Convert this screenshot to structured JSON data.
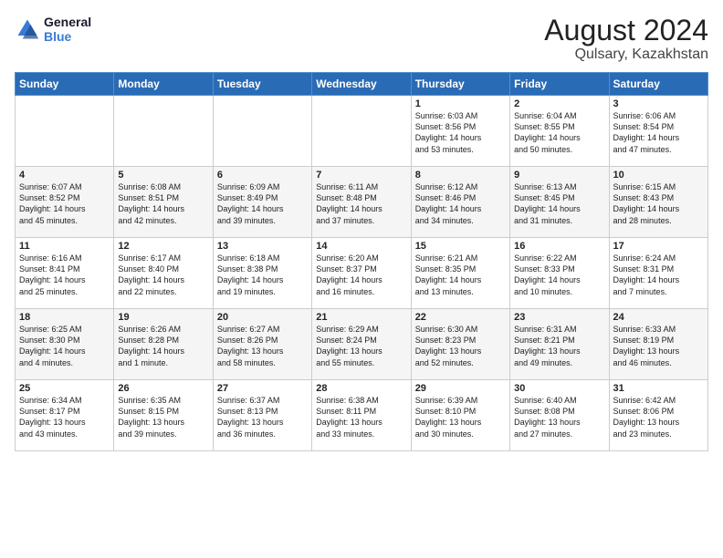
{
  "logo": {
    "line1": "General",
    "line2": "Blue"
  },
  "title": "August 2024",
  "location": "Qulsary, Kazakhstan",
  "headers": [
    "Sunday",
    "Monday",
    "Tuesday",
    "Wednesday",
    "Thursday",
    "Friday",
    "Saturday"
  ],
  "weeks": [
    [
      {
        "day": "",
        "text": ""
      },
      {
        "day": "",
        "text": ""
      },
      {
        "day": "",
        "text": ""
      },
      {
        "day": "",
        "text": ""
      },
      {
        "day": "1",
        "text": "Sunrise: 6:03 AM\nSunset: 8:56 PM\nDaylight: 14 hours\nand 53 minutes."
      },
      {
        "day": "2",
        "text": "Sunrise: 6:04 AM\nSunset: 8:55 PM\nDaylight: 14 hours\nand 50 minutes."
      },
      {
        "day": "3",
        "text": "Sunrise: 6:06 AM\nSunset: 8:54 PM\nDaylight: 14 hours\nand 47 minutes."
      }
    ],
    [
      {
        "day": "4",
        "text": "Sunrise: 6:07 AM\nSunset: 8:52 PM\nDaylight: 14 hours\nand 45 minutes."
      },
      {
        "day": "5",
        "text": "Sunrise: 6:08 AM\nSunset: 8:51 PM\nDaylight: 14 hours\nand 42 minutes."
      },
      {
        "day": "6",
        "text": "Sunrise: 6:09 AM\nSunset: 8:49 PM\nDaylight: 14 hours\nand 39 minutes."
      },
      {
        "day": "7",
        "text": "Sunrise: 6:11 AM\nSunset: 8:48 PM\nDaylight: 14 hours\nand 37 minutes."
      },
      {
        "day": "8",
        "text": "Sunrise: 6:12 AM\nSunset: 8:46 PM\nDaylight: 14 hours\nand 34 minutes."
      },
      {
        "day": "9",
        "text": "Sunrise: 6:13 AM\nSunset: 8:45 PM\nDaylight: 14 hours\nand 31 minutes."
      },
      {
        "day": "10",
        "text": "Sunrise: 6:15 AM\nSunset: 8:43 PM\nDaylight: 14 hours\nand 28 minutes."
      }
    ],
    [
      {
        "day": "11",
        "text": "Sunrise: 6:16 AM\nSunset: 8:41 PM\nDaylight: 14 hours\nand 25 minutes."
      },
      {
        "day": "12",
        "text": "Sunrise: 6:17 AM\nSunset: 8:40 PM\nDaylight: 14 hours\nand 22 minutes."
      },
      {
        "day": "13",
        "text": "Sunrise: 6:18 AM\nSunset: 8:38 PM\nDaylight: 14 hours\nand 19 minutes."
      },
      {
        "day": "14",
        "text": "Sunrise: 6:20 AM\nSunset: 8:37 PM\nDaylight: 14 hours\nand 16 minutes."
      },
      {
        "day": "15",
        "text": "Sunrise: 6:21 AM\nSunset: 8:35 PM\nDaylight: 14 hours\nand 13 minutes."
      },
      {
        "day": "16",
        "text": "Sunrise: 6:22 AM\nSunset: 8:33 PM\nDaylight: 14 hours\nand 10 minutes."
      },
      {
        "day": "17",
        "text": "Sunrise: 6:24 AM\nSunset: 8:31 PM\nDaylight: 14 hours\nand 7 minutes."
      }
    ],
    [
      {
        "day": "18",
        "text": "Sunrise: 6:25 AM\nSunset: 8:30 PM\nDaylight: 14 hours\nand 4 minutes."
      },
      {
        "day": "19",
        "text": "Sunrise: 6:26 AM\nSunset: 8:28 PM\nDaylight: 14 hours\nand 1 minute."
      },
      {
        "day": "20",
        "text": "Sunrise: 6:27 AM\nSunset: 8:26 PM\nDaylight: 13 hours\nand 58 minutes."
      },
      {
        "day": "21",
        "text": "Sunrise: 6:29 AM\nSunset: 8:24 PM\nDaylight: 13 hours\nand 55 minutes."
      },
      {
        "day": "22",
        "text": "Sunrise: 6:30 AM\nSunset: 8:23 PM\nDaylight: 13 hours\nand 52 minutes."
      },
      {
        "day": "23",
        "text": "Sunrise: 6:31 AM\nSunset: 8:21 PM\nDaylight: 13 hours\nand 49 minutes."
      },
      {
        "day": "24",
        "text": "Sunrise: 6:33 AM\nSunset: 8:19 PM\nDaylight: 13 hours\nand 46 minutes."
      }
    ],
    [
      {
        "day": "25",
        "text": "Sunrise: 6:34 AM\nSunset: 8:17 PM\nDaylight: 13 hours\nand 43 minutes."
      },
      {
        "day": "26",
        "text": "Sunrise: 6:35 AM\nSunset: 8:15 PM\nDaylight: 13 hours\nand 39 minutes."
      },
      {
        "day": "27",
        "text": "Sunrise: 6:37 AM\nSunset: 8:13 PM\nDaylight: 13 hours\nand 36 minutes."
      },
      {
        "day": "28",
        "text": "Sunrise: 6:38 AM\nSunset: 8:11 PM\nDaylight: 13 hours\nand 33 minutes."
      },
      {
        "day": "29",
        "text": "Sunrise: 6:39 AM\nSunset: 8:10 PM\nDaylight: 13 hours\nand 30 minutes."
      },
      {
        "day": "30",
        "text": "Sunrise: 6:40 AM\nSunset: 8:08 PM\nDaylight: 13 hours\nand 27 minutes."
      },
      {
        "day": "31",
        "text": "Sunrise: 6:42 AM\nSunset: 8:06 PM\nDaylight: 13 hours\nand 23 minutes."
      }
    ]
  ]
}
